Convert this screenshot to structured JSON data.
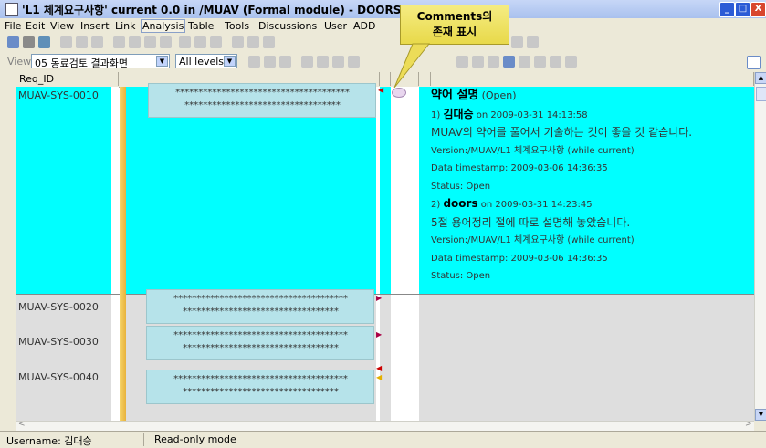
{
  "window": {
    "title": "'L1 체계요구사항' current 0.0 in /MUAV (Formal module) - DOORS",
    "minimize": "_",
    "maximize": "□",
    "close": "X"
  },
  "menu": [
    "File",
    "Edit",
    "View",
    "Insert",
    "Link",
    "Analysis",
    "Table",
    "Tools",
    "Discussions",
    "User",
    "ADD"
  ],
  "menu_active": "Analysis",
  "toolbar2": {
    "view_label": "View",
    "view_value": "05 동료검토 결과화면",
    "levels_value": "All levels"
  },
  "grid": {
    "header": [
      "Req_ID"
    ],
    "rows": [
      {
        "id": "MUAV-SYS-0010",
        "text": "**************************************\n**********************************"
      },
      {
        "id": "MUAV-SYS-0020",
        "text": "**************************************\n**********************************"
      },
      {
        "id": "MUAV-SYS-0030",
        "text": "**************************************\n**********************************"
      },
      {
        "id": "MUAV-SYS-0040",
        "text": "**************************************\n**********************************"
      }
    ]
  },
  "comments": {
    "heading": "약어 설명",
    "heading_status": "(Open)",
    "entries": [
      {
        "num": "1)",
        "author": "김대승",
        "date": "on 2009-03-31 14:13:58",
        "body": "MUAV의 약어를 풀어서 기술하는 것이 좋을 것 같습니다.",
        "version": "Version:/MUAV/L1 체계요구사항  (while current)",
        "timestamp": "Data timestamp: 2009-03-06 14:36:35",
        "status": "Status: Open"
      },
      {
        "num": "2)",
        "author": "doors",
        "date": "on 2009-03-31 14:23:45",
        "body": "5절 용어정리 절에 따로 설명해 놓았습니다.",
        "version": "Version:/MUAV/L1 체계요구사항  (while current)",
        "timestamp": "Data timestamp: 2009-03-06 14:36:35",
        "status": "Status: Open"
      }
    ]
  },
  "callout": {
    "line1": "Comments의",
    "line2": "존재 표시"
  },
  "statusbar": {
    "username": "Username: 김대승",
    "mode": "Read-only mode"
  },
  "colors": {
    "cyan": "#00ffff",
    "callout": "#f0e56a",
    "title_gradient": "#a9c1ee"
  }
}
